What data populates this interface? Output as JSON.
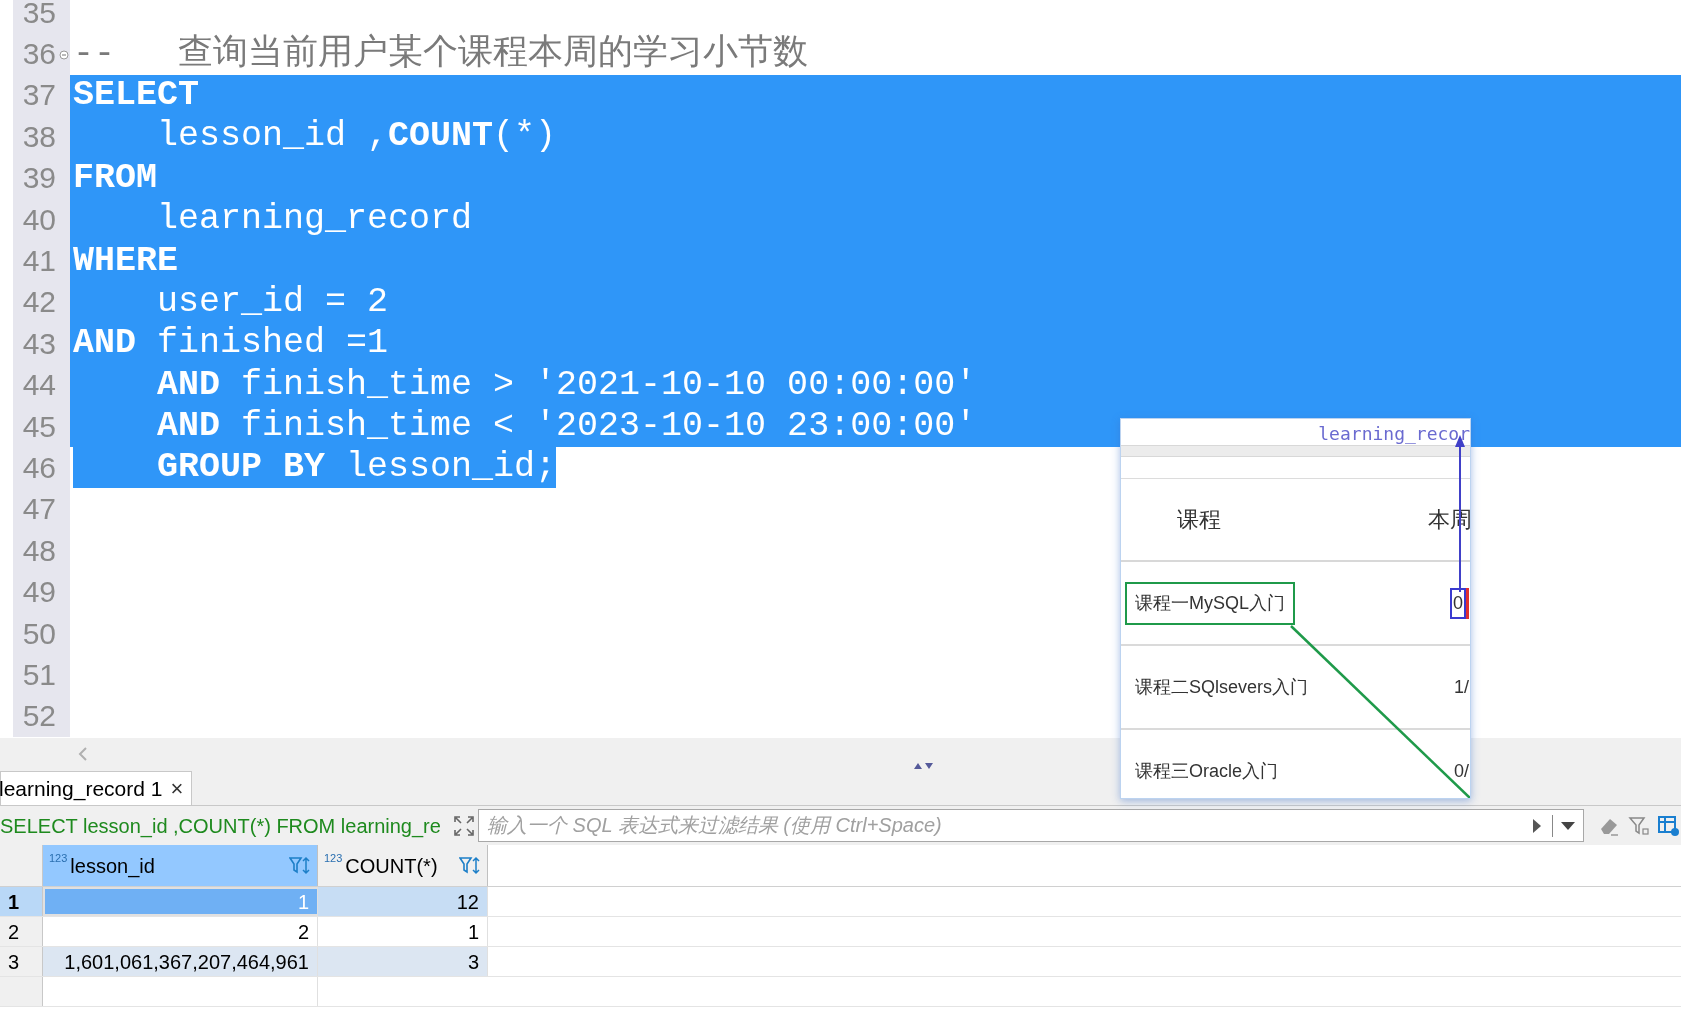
{
  "editor": {
    "lines": [
      {
        "number": "35",
        "foldable": false,
        "selected": false,
        "selection_ends_at_text": false
      },
      {
        "number": "36",
        "foldable": true,
        "selected": false,
        "selection_ends_at_text": false,
        "tokens": [
          {
            "kind": "comment",
            "text": "--   查询当前用户某个课程本周的学习小节数"
          }
        ]
      },
      {
        "number": "37",
        "foldable": false,
        "selected": true,
        "selection_ends_at_text": false,
        "tokens": [
          {
            "kind": "keyword",
            "text": "SELECT"
          }
        ]
      },
      {
        "number": "38",
        "foldable": false,
        "selected": true,
        "selection_ends_at_text": false,
        "tokens": [
          {
            "kind": "text",
            "text": "    lesson_id ,"
          },
          {
            "kind": "keyword",
            "text": "COUNT"
          },
          {
            "kind": "text",
            "text": "(*)"
          }
        ]
      },
      {
        "number": "39",
        "foldable": false,
        "selected": true,
        "selection_ends_at_text": false,
        "tokens": [
          {
            "kind": "keyword",
            "text": "FROM"
          }
        ]
      },
      {
        "number": "40",
        "foldable": false,
        "selected": true,
        "selection_ends_at_text": false,
        "tokens": [
          {
            "kind": "text",
            "text": "    learning_record"
          }
        ]
      },
      {
        "number": "41",
        "foldable": false,
        "selected": true,
        "selection_ends_at_text": false,
        "tokens": [
          {
            "kind": "keyword",
            "text": "WHERE"
          }
        ]
      },
      {
        "number": "42",
        "foldable": false,
        "selected": true,
        "selection_ends_at_text": false,
        "tokens": [
          {
            "kind": "text",
            "text": "    user_id = 2"
          }
        ]
      },
      {
        "number": "43",
        "foldable": false,
        "selected": true,
        "selection_ends_at_text": false,
        "tokens": [
          {
            "kind": "keyword",
            "text": "AND"
          },
          {
            "kind": "text",
            "text": " finished =1"
          }
        ]
      },
      {
        "number": "44",
        "foldable": false,
        "selected": true,
        "selection_ends_at_text": false,
        "tokens": [
          {
            "kind": "keyword",
            "text": "    AND"
          },
          {
            "kind": "text",
            "text": " finish_time > '2021-10-10 00:00:00'"
          }
        ]
      },
      {
        "number": "45",
        "foldable": false,
        "selected": true,
        "selection_ends_at_text": false,
        "tokens": [
          {
            "kind": "keyword",
            "text": "    AND"
          },
          {
            "kind": "text",
            "text": " finish_time < '2023-10-10 23:00:00'"
          }
        ]
      },
      {
        "number": "46",
        "foldable": false,
        "selected": true,
        "selection_ends_at_text": true,
        "tokens": [
          {
            "kind": "keyword",
            "text": "    GROUP BY"
          },
          {
            "kind": "text",
            "text": " lesson_id;"
          }
        ]
      },
      {
        "number": "47",
        "foldable": false,
        "selected": false,
        "selection_ends_at_text": false
      },
      {
        "number": "48",
        "foldable": false,
        "selected": false,
        "selection_ends_at_text": false
      },
      {
        "number": "49",
        "foldable": false,
        "selected": false,
        "selection_ends_at_text": false
      },
      {
        "number": "50",
        "foldable": false,
        "selected": false,
        "selection_ends_at_text": false
      },
      {
        "number": "51",
        "foldable": false,
        "selected": false,
        "selection_ends_at_text": false
      },
      {
        "number": "52",
        "foldable": false,
        "selected": false,
        "selection_ends_at_text": false
      }
    ]
  },
  "overlay": {
    "table_name": "learning_recor",
    "headers": [
      "课程",
      "本周"
    ],
    "rows": [
      {
        "course": "课程一MySQL入门",
        "value": "0",
        "highlighted": true
      },
      {
        "course": "课程二SQlsevers入门",
        "value": "1/",
        "highlighted": false
      },
      {
        "course": "课程三Oracle入门",
        "value": "0/",
        "highlighted": false
      }
    ]
  },
  "results": {
    "tab": {
      "label": "learning_record 1",
      "close": "×",
      "selected": true
    },
    "query_text": "SELECT lesson_id ,COUNT(*) FROM learning_re",
    "filter": {
      "placeholder": "输入一个 SQL 表达式来过滤结果 (使用 Ctrl+Space)"
    },
    "columns": [
      {
        "name": "lesson_id",
        "type_label": "123",
        "selected": true
      },
      {
        "name": "COUNT(*)",
        "type_label": "123",
        "selected": false
      }
    ],
    "rows": [
      {
        "number": "1",
        "cells": [
          "1",
          "12"
        ],
        "selected": true
      },
      {
        "number": "2",
        "cells": [
          "2",
          "1"
        ],
        "selected": false
      },
      {
        "number": "3",
        "cells": [
          "1,601,061,367,207,464,961",
          "3"
        ],
        "selected": false
      }
    ]
  }
}
